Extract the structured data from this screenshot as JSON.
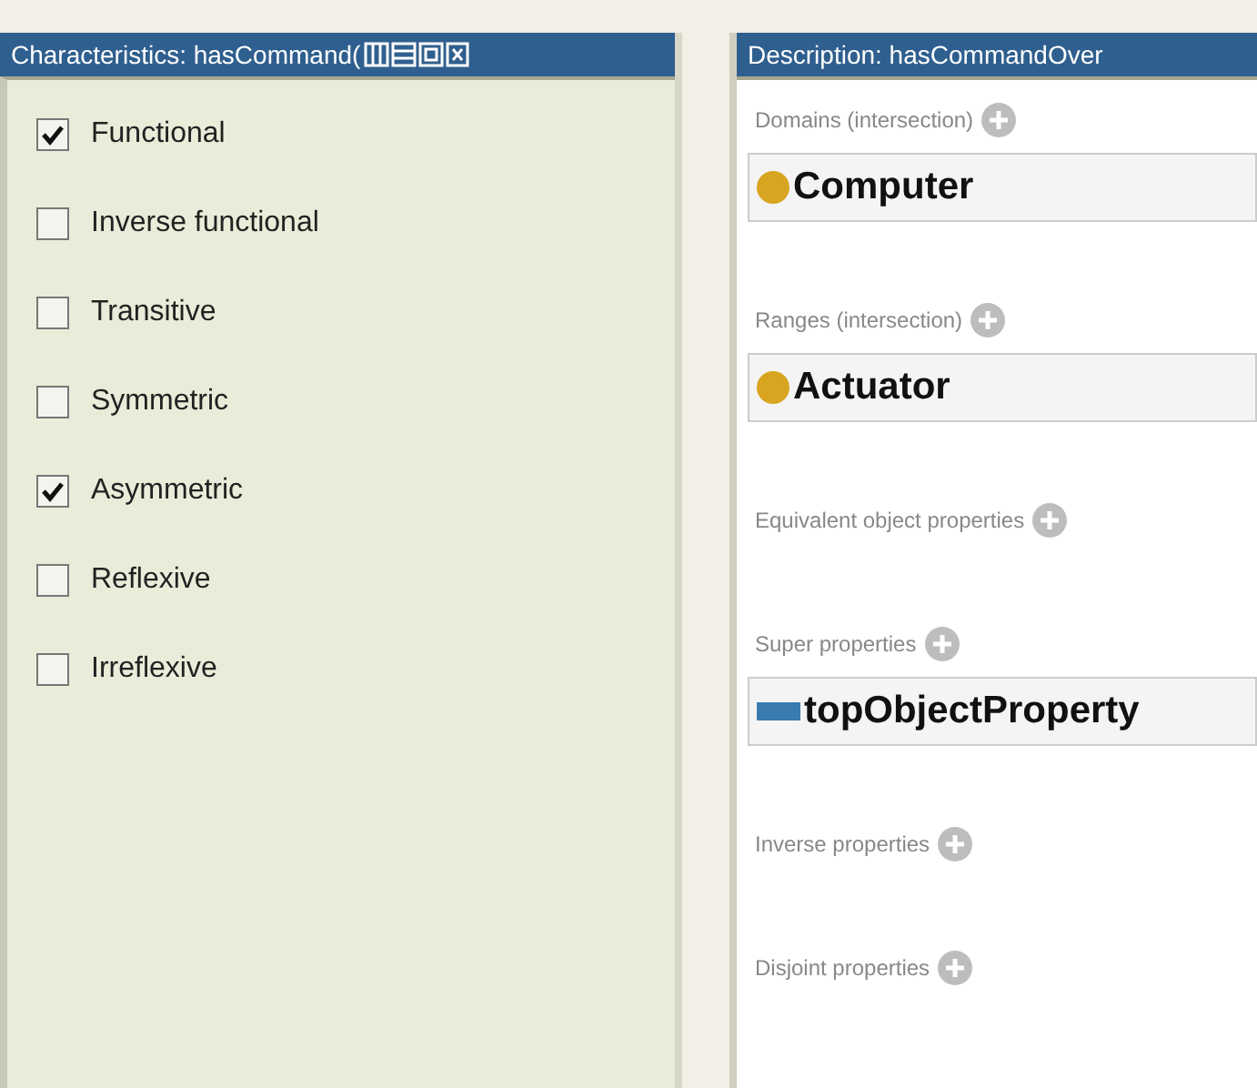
{
  "characteristics": {
    "title": "Characteristics: hasCommand(",
    "items": [
      {
        "label": "Functional",
        "checked": true
      },
      {
        "label": "Inverse functional",
        "checked": false
      },
      {
        "label": "Transitive",
        "checked": false
      },
      {
        "label": "Symmetric",
        "checked": false
      },
      {
        "label": "Asymmetric",
        "checked": true
      },
      {
        "label": "Reflexive",
        "checked": false
      },
      {
        "label": "Irreflexive",
        "checked": false
      }
    ]
  },
  "description": {
    "title": "Description: hasCommandOver",
    "sections": [
      {
        "label": "Domains (intersection)",
        "items": [
          {
            "name": "Computer",
            "kind": "class"
          }
        ]
      },
      {
        "label": "Ranges (intersection)",
        "items": [
          {
            "name": "Actuator",
            "kind": "class"
          }
        ]
      },
      {
        "label": "Equivalent object properties"
      },
      {
        "label": "Super properties",
        "items": [
          {
            "name": "topObjectProperty",
            "kind": "property"
          }
        ]
      },
      {
        "label": "Inverse properties"
      },
      {
        "label": "Disjoint properties"
      }
    ]
  }
}
